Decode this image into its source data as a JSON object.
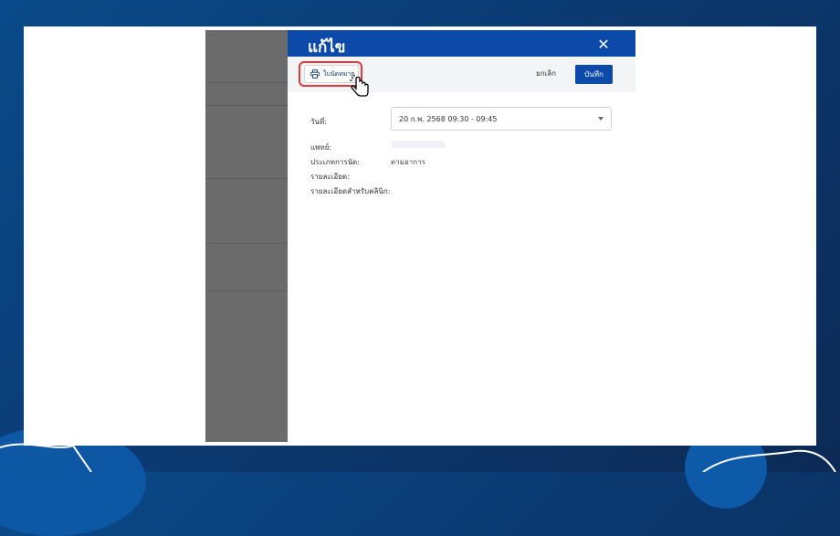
{
  "dialog": {
    "title": "แก้ไข",
    "close_icon": "close-icon"
  },
  "toolbar": {
    "print_label": "ใบนัดหมาย",
    "print_icon": "printer-icon",
    "cancel_label": "ยกเลิก",
    "save_label": "บันทึก"
  },
  "form": {
    "date_label": "วันที่:",
    "date_value": "20 ก.พ. 2568 09:30 - 09:45",
    "doctor_label": "แพทย์:",
    "appointment_type_label": "ประเภทการนัด:",
    "appointment_type_value": "ตามอาการ",
    "details_label": "รายละเอียด:",
    "clinic_details_label": "รายละเอียดสำหรับคลินิก:"
  },
  "colors": {
    "header_blue": "#0b4aa8",
    "highlight_red": "#e23a3a",
    "overlay_gray": "#6b6b6b"
  }
}
